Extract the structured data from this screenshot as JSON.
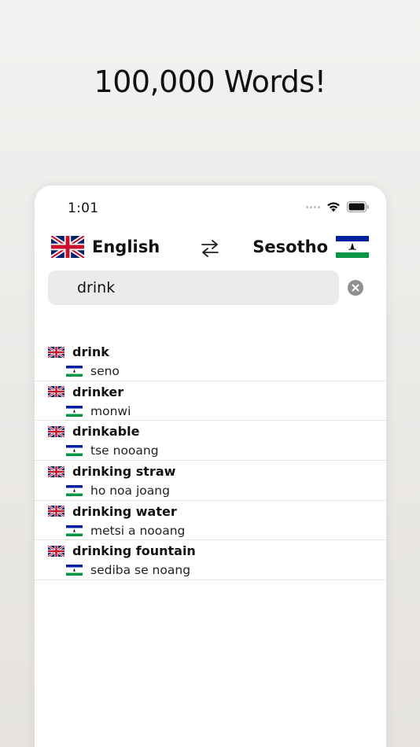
{
  "headline": "100,000 Words!",
  "status_bar": {
    "time": "1:01"
  },
  "languages": {
    "from": "English",
    "to": "Sesotho"
  },
  "search": {
    "value": "drink"
  },
  "results": [
    {
      "term": "drink",
      "translation": "seno"
    },
    {
      "term": "drinker",
      "translation": "monwi"
    },
    {
      "term": "drinkable",
      "translation": "tse nooang"
    },
    {
      "term": "drinking straw",
      "translation": "ho noa joang"
    },
    {
      "term": "drinking water",
      "translation": "metsi a nooang"
    },
    {
      "term": "drinking fountain",
      "translation": "sediba se noang"
    }
  ],
  "icons": {
    "source_flag": "uk-flag-icon",
    "target_flag": "lesotho-flag-icon",
    "swap": "swap-arrows-icon",
    "clear": "clear-icon"
  },
  "colors": {
    "lesotho_blue": "#00209f",
    "lesotho_green": "#009543",
    "uk_blue": "#012169",
    "uk_red": "#c8102e"
  }
}
